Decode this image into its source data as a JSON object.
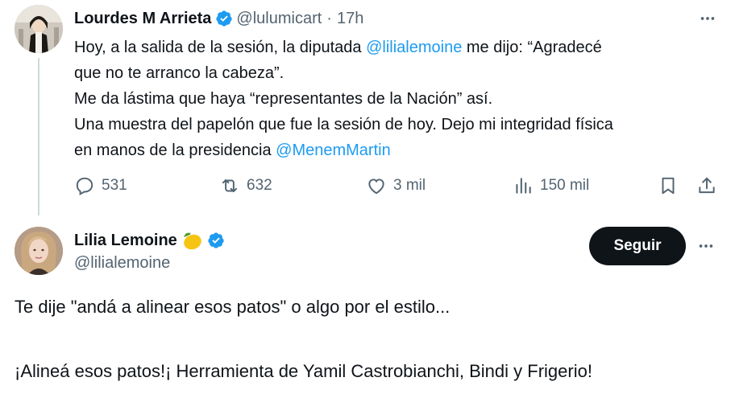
{
  "tweet1": {
    "author_name": "Lourdes M Arrieta",
    "handle": "@lulumicart",
    "time": "17h",
    "text_lines": [
      {
        "pre": "Hoy, a la salida de la sesión, la diputada ",
        "link": "@lilialemoine",
        "post": " me dijo: “Agradecé"
      },
      {
        "pre": "que no te arranco la cabeza”.",
        "link": "",
        "post": ""
      },
      {
        "pre": "Me da lástima que haya “representantes de la Nación” así.",
        "link": "",
        "post": ""
      },
      {
        "pre": "Una muestra del papelón que fue la sesión de hoy. Dejo mi integridad física",
        "link": "",
        "post": ""
      },
      {
        "pre": "en manos de la presidencia ",
        "link": "@MenemMartin",
        "post": ""
      }
    ],
    "stats": {
      "replies": "531",
      "retweets": "632",
      "likes": "3 mil",
      "views": "150 mil"
    },
    "icons": [
      "verified-badge-icon",
      "more-icon",
      "reply-icon",
      "retweet-icon",
      "like-icon",
      "views-icon",
      "bookmark-icon",
      "share-icon"
    ]
  },
  "tweet2": {
    "author_name": "Lilia Lemoine",
    "handle": "@lilialemoine",
    "follow_label": "Seguir",
    "text_paragraphs": [
      "Te dije \"andá a alinear esos patos\" o algo por el estilo...",
      "¡Alineá esos patos!¡ Herramienta de Yamil Castrobianchi, Bindi y Frigerio!"
    ],
    "icons": [
      "lemon-emoji-icon",
      "verified-badge-icon",
      "more-icon"
    ]
  },
  "colors": {
    "text": "#0f1419",
    "muted": "#536471",
    "link": "#1d9bf0",
    "verified": "#1d9bf0",
    "follow_bg": "#0f1419",
    "thread_line": "#cfd9de"
  }
}
